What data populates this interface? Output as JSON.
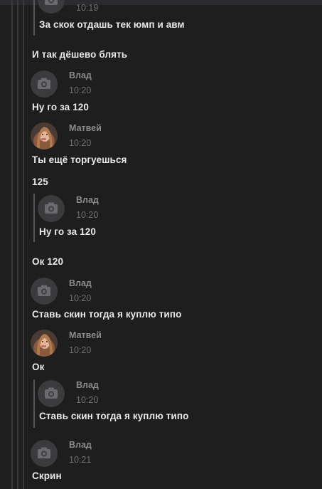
{
  "messages": {
    "m0_time": "10:19",
    "m0_quote_text": "За скок отдашь тек юмп и авм",
    "m1_text": "И так дёшево блять",
    "m2_name": "Влад",
    "m2_time": "10:20",
    "m2_text": "Ну го за 120",
    "m3_name": "Матвей",
    "m3_time": "10:20",
    "m3_text": "Ты ещё торгуешься",
    "m4_text": "125",
    "m4_quote_name": "Влад",
    "m4_quote_time": "10:20",
    "m4_quote_text": "Ну го за 120",
    "m5_text": "Ок 120",
    "m6_name": "Влад",
    "m6_time": "10:20",
    "m6_text": "Ставь скин тогда я куплю типо",
    "m7_name": "Матвей",
    "m7_time": "10:20",
    "m7_text": "Ок",
    "m7_quote_name": "Влад",
    "m7_quote_time": "10:20",
    "m7_quote_text": "Ставь скин тогда я куплю типо",
    "m8_name": "Влад",
    "m8_time": "10:21",
    "m8_text": "Скрин"
  },
  "icons": {
    "placeholder_avatar": "camera-icon",
    "user_avatar": "profile-photo"
  },
  "colors": {
    "background": "#1e1e1f",
    "text": "#e8e8e8",
    "name": "#8a8b8d",
    "time": "#6f7072"
  }
}
